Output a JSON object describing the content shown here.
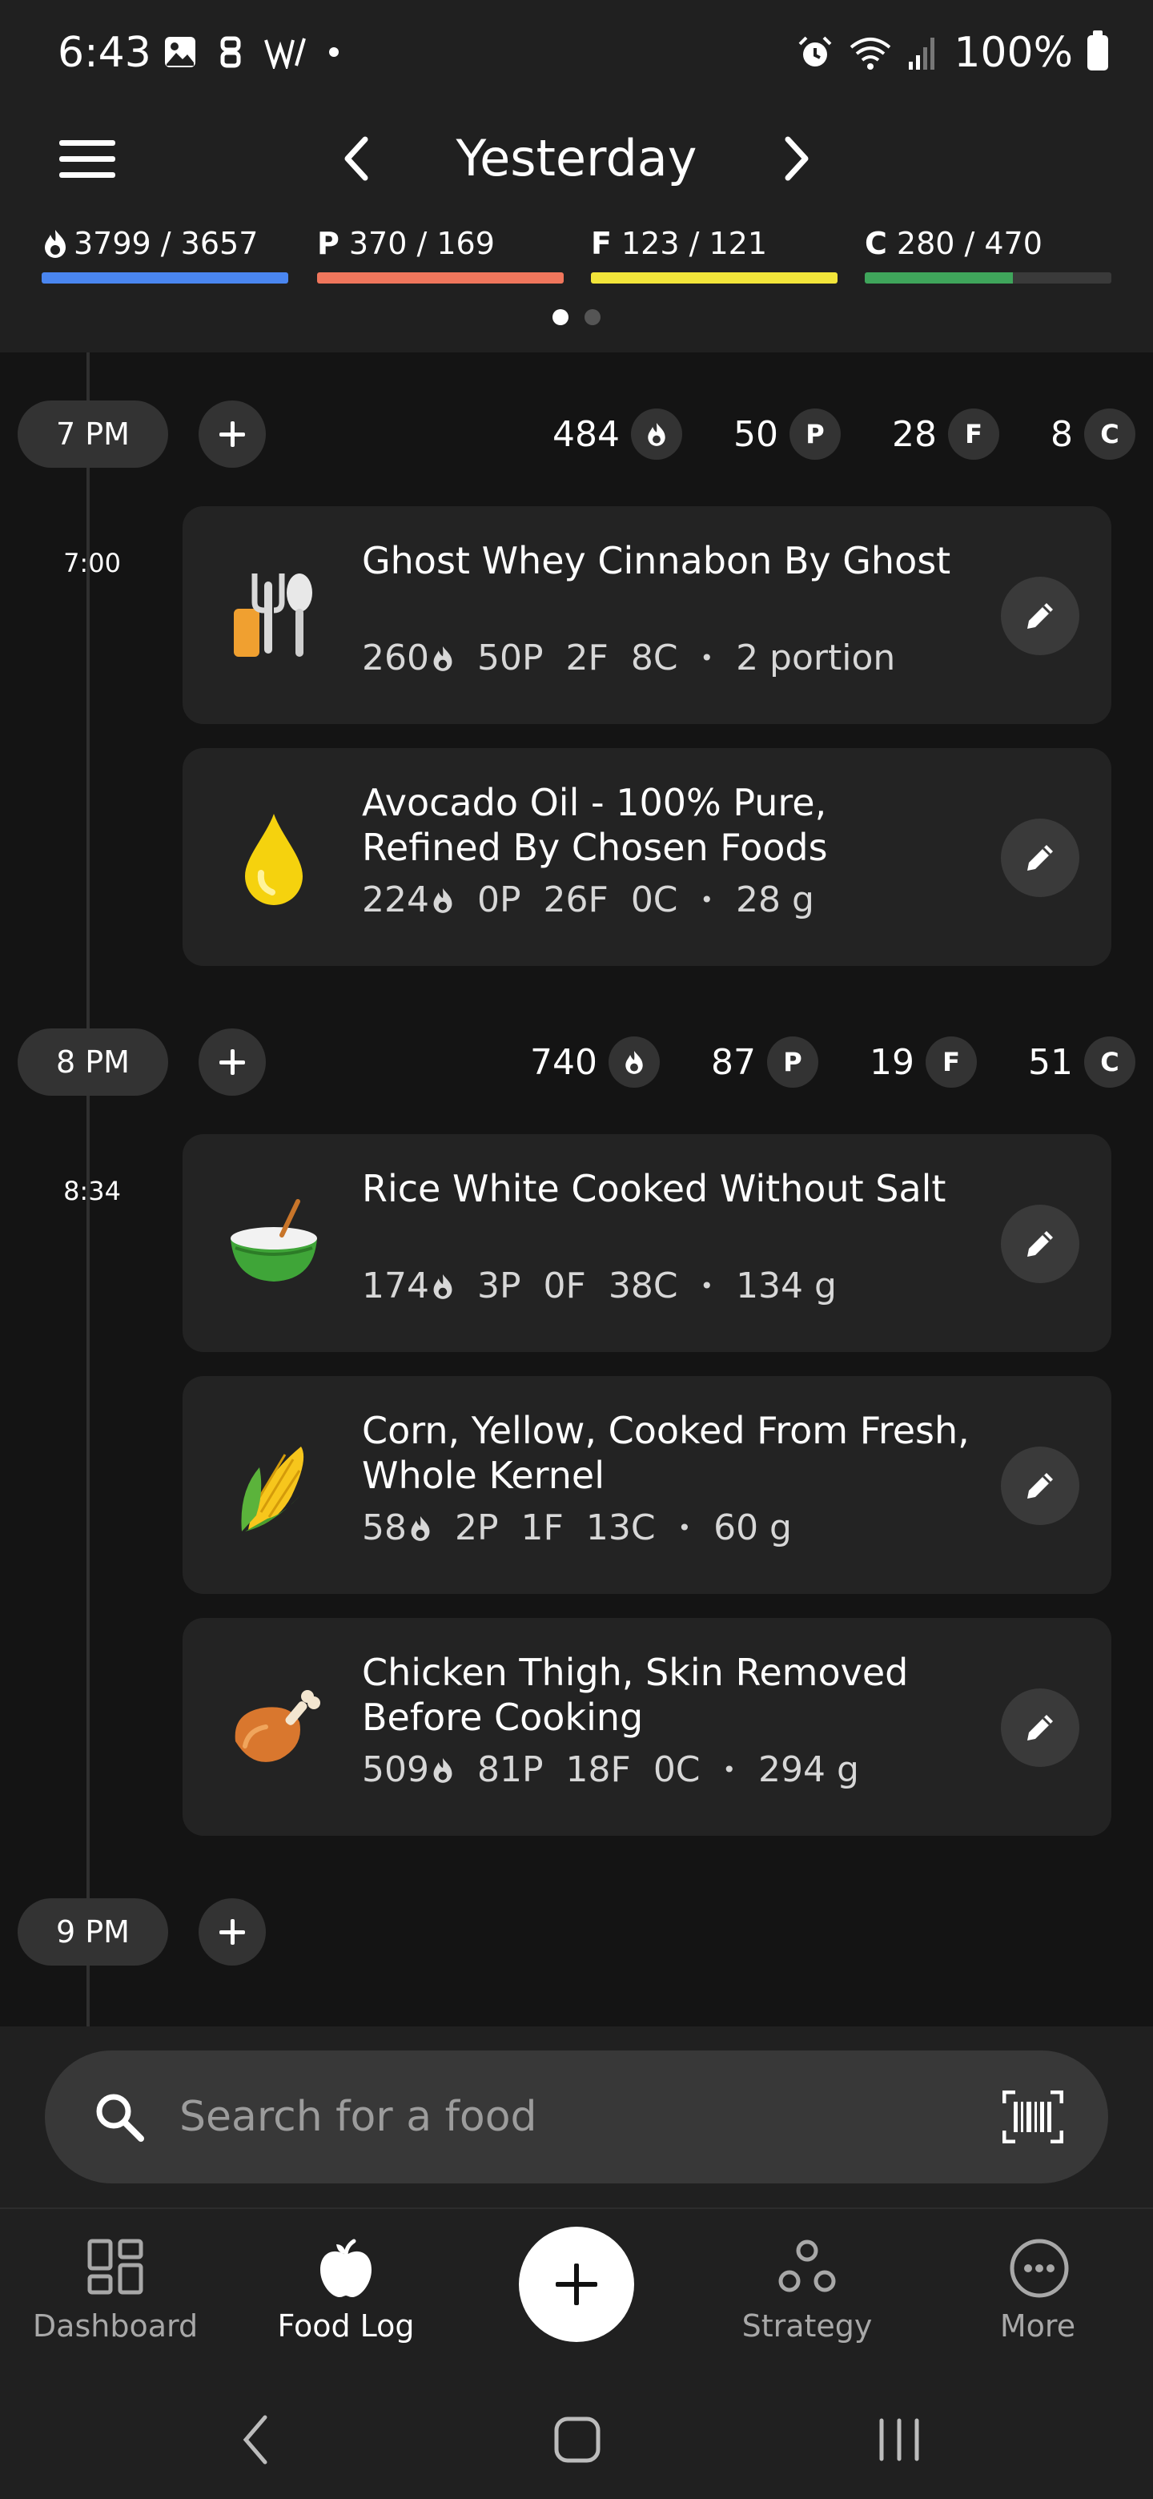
{
  "status_bar": {
    "time": "6:43",
    "battery_pct": "100%"
  },
  "header": {
    "date_label": "Yesterday",
    "macros": [
      {
        "key": "calories",
        "letter": "",
        "value": "3799 / 3657",
        "color": "#4a86f0",
        "fill": 1.0
      },
      {
        "key": "protein",
        "letter": "P",
        "value": "370 / 169",
        "color": "#f0765c",
        "fill": 1.0
      },
      {
        "key": "fat",
        "letter": "F",
        "value": "123 / 121",
        "color": "#f2e53a",
        "fill": 1.0
      },
      {
        "key": "carbs",
        "letter": "C",
        "value": "280 / 470",
        "color": "#3fa55b",
        "fill": 0.6
      }
    ],
    "page_count": 2,
    "active_page": 0
  },
  "timeline": {
    "hours": [
      {
        "label": "7 PM",
        "cal": "484",
        "protein": "50",
        "fat": "28",
        "carbs": "8"
      },
      {
        "label": "8 PM",
        "cal": "740",
        "protein": "87",
        "fat": "19",
        "carbs": "51"
      },
      {
        "label": "9 PM"
      }
    ],
    "badge_letters": {
      "protein": "P",
      "fat": "F",
      "carbs": "C"
    },
    "entries": [
      {
        "time": "7:00"
      },
      {
        "time": "8:34"
      }
    ],
    "foods": [
      {
        "name": "Ghost Whey Cinnabon By Ghost",
        "cal": "260",
        "protein": "50P",
        "fat": "2F",
        "carbs": "8C",
        "amount": "2 portion",
        "icon": "fork-knife-icon"
      },
      {
        "name": "Avocado Oil - 100% Pure, Refined By Chosen Foods",
        "cal": "224",
        "protein": "0P",
        "fat": "26F",
        "carbs": "0C",
        "amount": "28 g",
        "icon": "oil-drop-icon"
      },
      {
        "name": "Rice White Cooked Without Salt",
        "cal": "174",
        "protein": "3P",
        "fat": "0F",
        "carbs": "38C",
        "amount": "134 g",
        "icon": "rice-bowl-icon"
      },
      {
        "name": "Corn, Yellow, Cooked From Fresh, Whole Kernel",
        "cal": "58",
        "protein": "2P",
        "fat": "1F",
        "carbs": "13C",
        "amount": "60 g",
        "icon": "corn-icon"
      },
      {
        "name": "Chicken Thigh, Skin Removed Before Cooking",
        "cal": "509",
        "protein": "81P",
        "fat": "18F",
        "carbs": "0C",
        "amount": "294 g",
        "icon": "chicken-leg-icon"
      }
    ],
    "separator": "•"
  },
  "search": {
    "placeholder": "Search for a food"
  },
  "bottom_nav": {
    "items": [
      {
        "label": "Dashboard",
        "icon": "dashboard-icon"
      },
      {
        "label": "Food Log",
        "icon": "apple-icon",
        "active": true
      },
      {
        "label": "Strategy",
        "icon": "strategy-icon"
      },
      {
        "label": "More",
        "icon": "more-icon"
      }
    ]
  }
}
